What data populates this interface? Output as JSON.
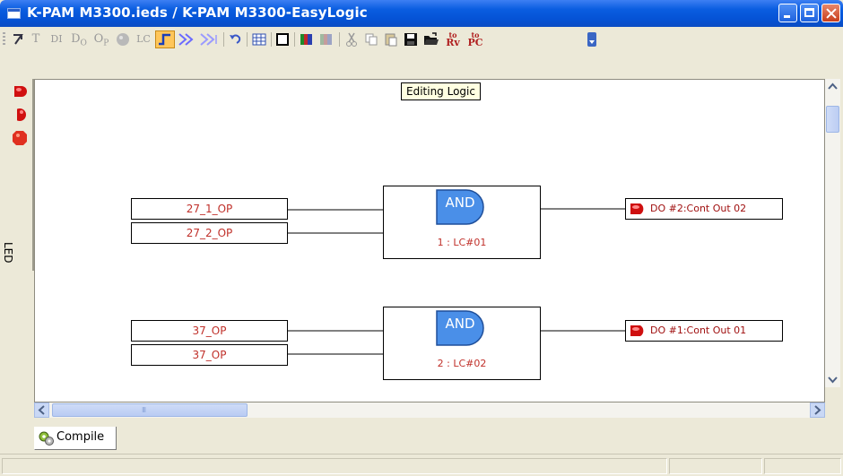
{
  "window": {
    "title": "K-PAM M3300.ieds / K-PAM M3300-EasyLogic"
  },
  "toolbar": {
    "t": "T",
    "di": "DI",
    "do_base": "D",
    "do_sub": "O",
    "op_base": "O",
    "op_sub": "P",
    "lc": "LC",
    "to_rv_top": "to",
    "to_rv_bottom": "Rv",
    "to_pc_top": "to",
    "to_pc_bottom": "PC"
  },
  "left_panel": {
    "label": "LED"
  },
  "canvas": {
    "tooltip": "Editing Logic",
    "gates": [
      {
        "inputs": [
          "27_1_OP",
          "27_2_OP"
        ],
        "type": "AND",
        "id": "1 : LC#01",
        "output": "DO #2:Cont Out 02"
      },
      {
        "inputs": [
          "37_OP",
          "37_OP"
        ],
        "type": "AND",
        "id": "2 : LC#02",
        "output": "DO #1:Cont Out 01"
      }
    ]
  },
  "tabs": {
    "compile": "Compile"
  },
  "colors": {
    "title_bar": "#0553d6",
    "gate_fill": "#4a8fe8",
    "signal_text": "#c0302a",
    "led_red": "#e01010"
  }
}
